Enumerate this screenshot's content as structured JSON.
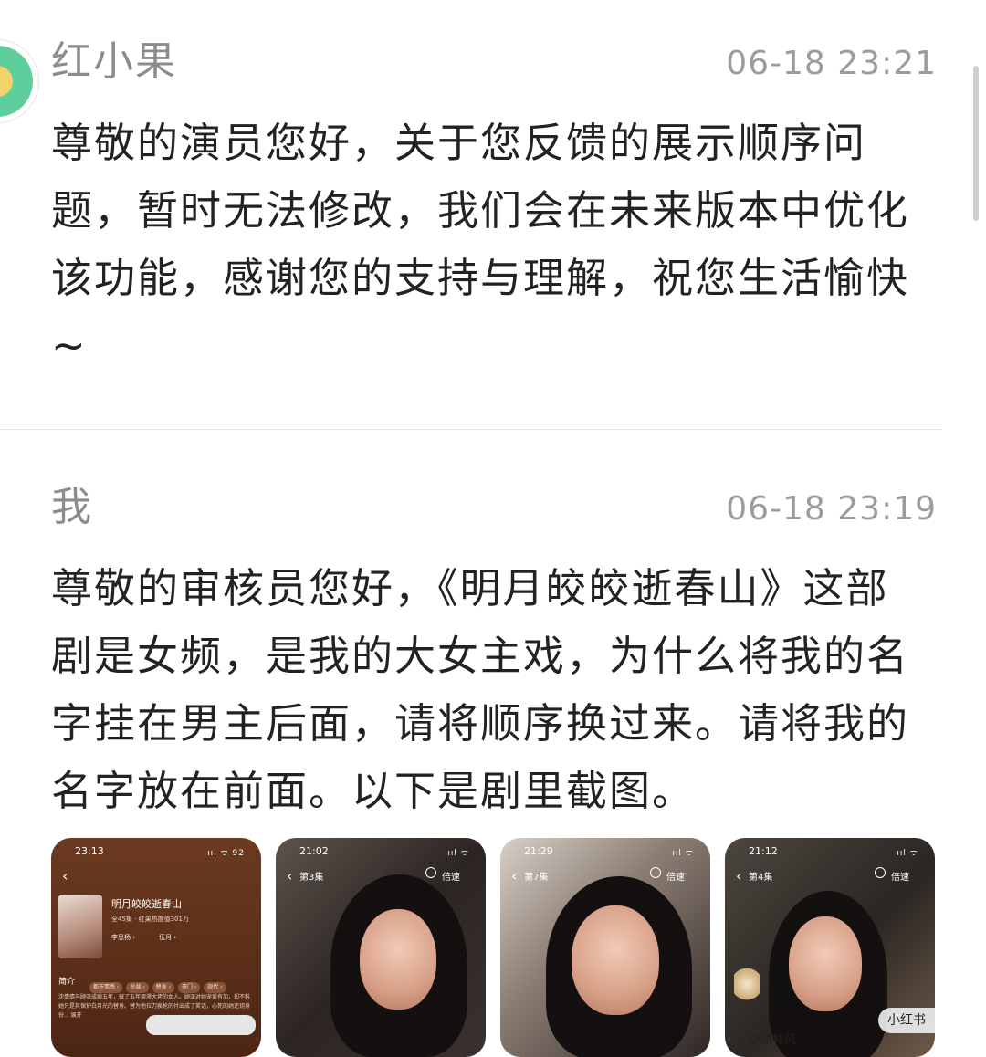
{
  "messages": [
    {
      "sender": "红小果",
      "time": "06-18 23:21",
      "text": "尊敬的演员您好，关于您反馈的展示顺序问题，暂时无法修改，我们会在未来版本中优化该功能，感谢您的支持与理解，祝您生活愉快~"
    },
    {
      "sender": "我",
      "time": "06-18 23:19",
      "text": "尊敬的审核员您好，《明月皎皎逝春山》这部剧是女频，是我的大女主戏，为什么将我的名字挂在男主后面，请将顺序换过来。请将我的名字放在前面。以下是剧里截图。"
    }
  ],
  "thumbnails": [
    {
      "clock": "23:13",
      "signal": "ııl ᯤ 92",
      "show_title": "明月皎皎逝春山",
      "meta": "全45集 · 红果热度值301万",
      "cast": [
        "李思杨 ›",
        "伍月 ›"
      ],
      "intro_label": "简介",
      "tags": [
        "都市情感 ›",
        "总裁 ›",
        "替身 ›",
        "豪门 ›",
        "现代 ›"
      ],
      "description": "沈倩倩与顾泽成婚五年，做了五年周漫大佬的女人。顾泽对她宠爱有加，却不料她只是其保护白月光的替身。替为他拉刀挨枪的付出成了笑话，心死的她还钥身份... 展开"
    },
    {
      "clock": "21:02",
      "signal": "ııl ᯤ",
      "episode": "第3集",
      "speed": "倍速"
    },
    {
      "clock": "21:29",
      "signal": "ııl ᯤ",
      "episode": "第7集",
      "speed": "倍速"
    },
    {
      "clock": "21:12",
      "signal": "ııl ᯤ",
      "episode": "第4集",
      "speed": "倍速",
      "watermark": "小红书"
    }
  ],
  "caption_fragment": "小绣林风"
}
